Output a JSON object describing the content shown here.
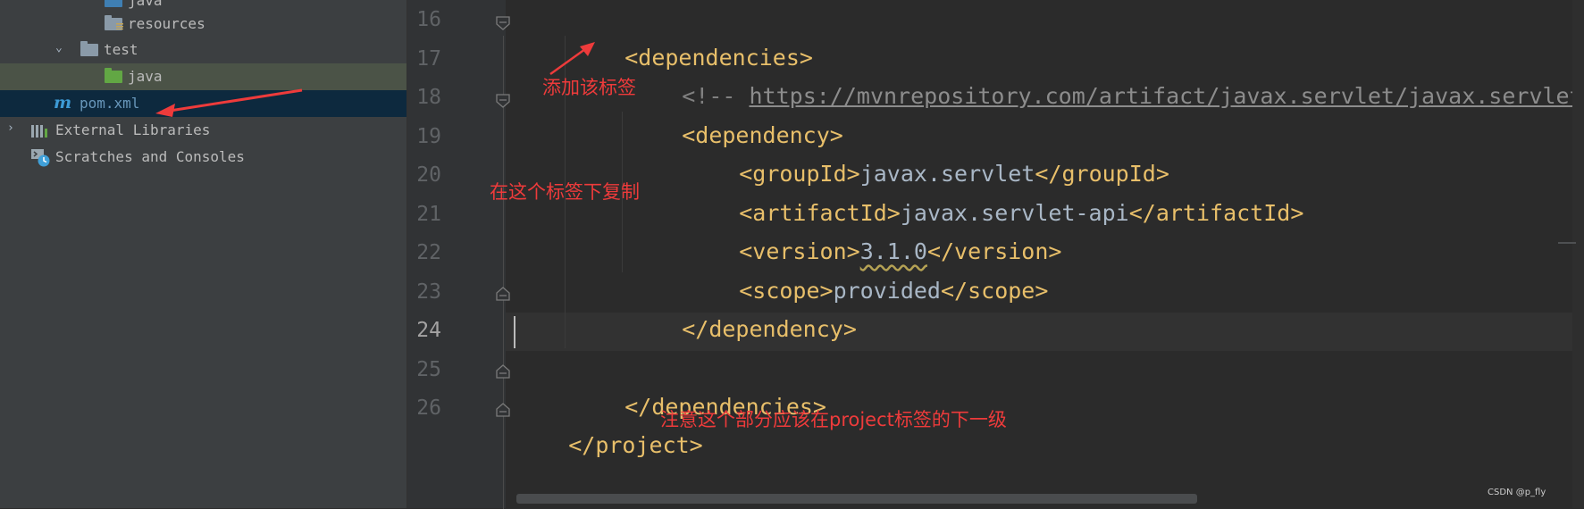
{
  "project_tree": {
    "items": [
      {
        "label": "java",
        "icon": "folder-source-icon",
        "color": "#3f7fb3"
      },
      {
        "label": "resources",
        "icon": "folder-resources-icon",
        "color": "#8a9aa8"
      },
      {
        "label": "test",
        "icon": "folder-icon",
        "color": "#8a9aa8"
      },
      {
        "label": "java",
        "icon": "folder-test-source-icon",
        "color": "#62a744"
      },
      {
        "label": "pom.xml",
        "icon": "maven-icon",
        "color": "#3d9bd6"
      },
      {
        "label": "External Libraries",
        "icon": "libraries-icon"
      },
      {
        "label": "Scratches and Consoles",
        "icon": "scratches-icon"
      }
    ]
  },
  "editor": {
    "line_numbers": [
      "16",
      "17",
      "18",
      "19",
      "20",
      "21",
      "22",
      "23",
      "24",
      "25",
      "26"
    ],
    "current_line": "24",
    "lines": {
      "l16": "<dependencies>",
      "l17_comment_start": "<!-- ",
      "l17_url": "https://mvnrepository.com/artifact/javax.servlet/javax.servlet-api",
      "l18": "<dependency>",
      "l19_open": "<groupId>",
      "l19_value": "javax.servlet",
      "l19_close": "</groupId>",
      "l20_open": "<artifactId>",
      "l20_value": "javax.servlet-api",
      "l20_close": "</artifactId>",
      "l21_open": "<version>",
      "l21_value": "3.1.0",
      "l21_close": "</version>",
      "l22_open": "<scope>",
      "l22_value": "provided",
      "l22_close": "</scope>",
      "l23": "</dependency>",
      "l25": "</dependencies>",
      "l26": "</project>"
    }
  },
  "annotations": {
    "add_tag": "添加该标签",
    "copy_under": "在这个标签下复制",
    "note_level": "注意这个部分应该在project标签的下一级"
  },
  "watermark": "CSDN @p_fly",
  "colors": {
    "annotation": "#ee3b3b",
    "xml_tag": "#e8bf6a",
    "text": "#a9b7c6",
    "comment": "#808080"
  }
}
